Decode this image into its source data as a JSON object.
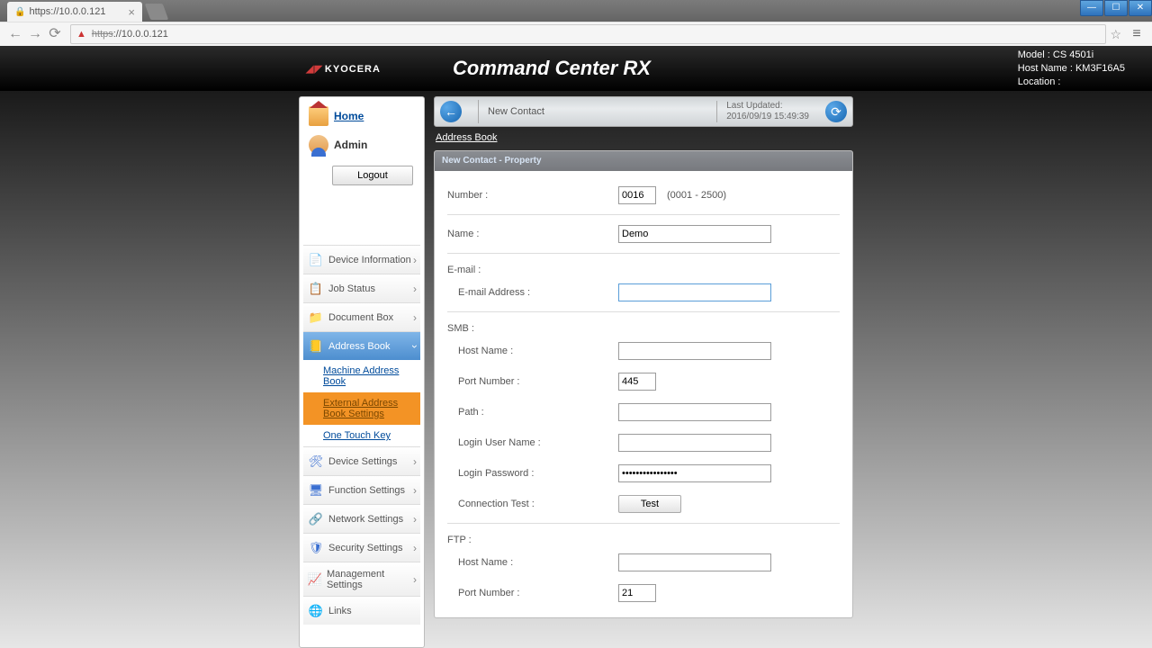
{
  "browser": {
    "tab_url": "https://10.0.0.121",
    "url_protocol": "https",
    "url_host": "://10.0.0.121"
  },
  "brand": {
    "company": "KYOCERA",
    "product": "Command Center RX"
  },
  "device": {
    "model_label": "Model :",
    "model": "CS 4501i",
    "hostname_label": "Host Name :",
    "hostname": "KM3F16A5",
    "location_label": "Location :",
    "location": ""
  },
  "sidebar": {
    "home": "Home",
    "admin": "Admin",
    "logout": "Logout",
    "items": [
      {
        "label": "Device Information",
        "icon": "📄"
      },
      {
        "label": "Job Status",
        "icon": "📋"
      },
      {
        "label": "Document Box",
        "icon": "📁"
      },
      {
        "label": "Address Book",
        "icon": "📒",
        "active": true
      },
      {
        "label": "Device Settings",
        "icon": "🛠"
      },
      {
        "label": "Function Settings",
        "icon": "🖥"
      },
      {
        "label": "Network Settings",
        "icon": "🔗"
      },
      {
        "label": "Security Settings",
        "icon": "🛡"
      },
      {
        "label": "Management Settings",
        "icon": "📈"
      },
      {
        "label": "Links",
        "icon": "🌐"
      }
    ],
    "sub": {
      "machine": "Machine Address Book",
      "external": "External Address Book Settings",
      "onetouch": "One Touch Key"
    }
  },
  "titlebar": {
    "title": "New Contact",
    "updated_label": "Last Updated:",
    "updated": "2016/09/19 15:49:39"
  },
  "breadcrumb": "Address Book",
  "panel": {
    "header": "New Contact - Property"
  },
  "form": {
    "number_label": "Number :",
    "number": "0016",
    "number_range": "(0001 - 2500)",
    "name_label": "Name :",
    "name": "Demo",
    "email_section": "E-mail :",
    "email_label": "E-mail Address :",
    "email": "",
    "smb_section": "SMB :",
    "hostname_label": "Host Name :",
    "smb_hostname": "",
    "port_label": "Port Number :",
    "smb_port": "445",
    "path_label": "Path :",
    "smb_path": "",
    "login_user_label": "Login User Name :",
    "smb_user": "",
    "login_pw_label": "Login Password :",
    "smb_pw": "••••••••••••••••",
    "conn_test_label": "Connection Test :",
    "test_btn": "Test",
    "ftp_section": "FTP :",
    "ftp_hostname_label": "Host Name :",
    "ftp_hostname": "",
    "ftp_port_label": "Port Number :",
    "ftp_port": "21"
  }
}
